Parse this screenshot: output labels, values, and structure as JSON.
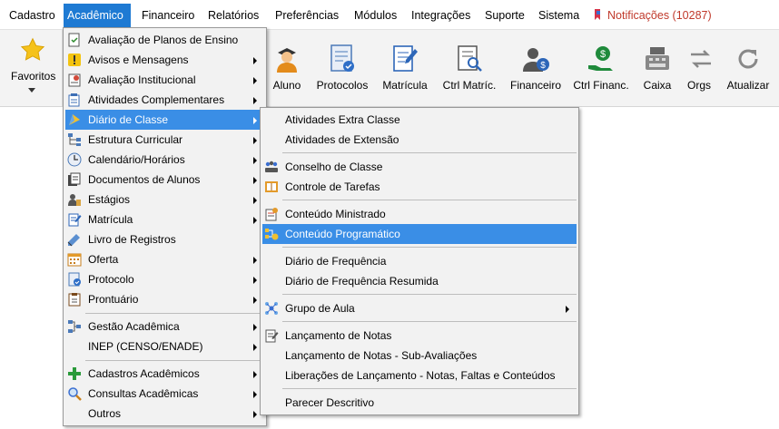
{
  "menubar": {
    "items": [
      "Cadastro",
      "Acadêmico",
      "Financeiro",
      "Relatórios",
      "Preferências",
      "Módulos",
      "Integrações",
      "Suporte",
      "Sistema"
    ],
    "notifications": "Notificações (10287)"
  },
  "toolbar": {
    "favorites": "Favoritos",
    "buttons": [
      "Aluno",
      "Protocolos",
      "Matrícula",
      "Ctrl Matríc.",
      "Financeiro",
      "Ctrl Financ.",
      "Caixa",
      "Orgs",
      "Atualizar"
    ]
  },
  "academic_menu": {
    "items": [
      {
        "label": "Avaliação de Planos de Ensino",
        "icon": "document-check-icon",
        "submenu": false
      },
      {
        "label": "Avisos e Mensagens",
        "icon": "warning-icon",
        "submenu": true
      },
      {
        "label": "Avaliação Institucional",
        "icon": "evaluation-icon",
        "submenu": true
      },
      {
        "label": "Atividades Complementares",
        "icon": "activities-icon",
        "submenu": true
      },
      {
        "label": "Diário de Classe",
        "icon": "class-diary-icon",
        "submenu": true
      },
      {
        "label": "Estrutura Curricular",
        "icon": "curriculum-structure-icon",
        "submenu": true
      },
      {
        "label": "Calendário/Horários",
        "icon": "calendar-icon",
        "submenu": true
      },
      {
        "label": "Documentos de Alunos",
        "icon": "student-documents-icon",
        "submenu": true
      },
      {
        "label": "Estágios",
        "icon": "internship-icon",
        "submenu": true
      },
      {
        "label": "Matrícula",
        "icon": "enrollment-icon",
        "submenu": true
      },
      {
        "label": "Livro de Registros",
        "icon": "register-book-icon",
        "submenu": false
      },
      {
        "label": "Oferta",
        "icon": "offer-icon",
        "submenu": true
      },
      {
        "label": "Protocolo",
        "icon": "protocol-icon",
        "submenu": true
      },
      {
        "label": "Prontuário",
        "icon": "record-icon",
        "submenu": true
      },
      {
        "label": "Gestão Acadêmica",
        "icon": "management-icon",
        "submenu": true
      },
      {
        "label": "INEP (CENSO/ENADE)",
        "icon": "",
        "submenu": true
      },
      {
        "label": "Cadastros Acadêmicos",
        "icon": "plus-icon",
        "submenu": true
      },
      {
        "label": "Consultas Acadêmicas",
        "icon": "magnifier-icon",
        "submenu": true
      },
      {
        "label": "Outros",
        "icon": "",
        "submenu": true
      }
    ]
  },
  "diary_submenu": {
    "items": [
      {
        "label": "Atividades Extra Classe",
        "icon": "",
        "submenu": false
      },
      {
        "label": "Atividades de Extensão",
        "icon": "",
        "submenu": false
      },
      {
        "label": "Conselho de Classe",
        "icon": "council-icon",
        "submenu": false
      },
      {
        "label": "Controle de Tarefas",
        "icon": "tasks-icon",
        "submenu": false
      },
      {
        "label": "Conteúdo Ministrado",
        "icon": "content-taught-icon",
        "submenu": false
      },
      {
        "label": "Conteúdo Programático",
        "icon": "program-content-icon",
        "submenu": false
      },
      {
        "label": "Diário de Frequência",
        "icon": "",
        "submenu": false
      },
      {
        "label": "Diário de Frequência Resumida",
        "icon": "",
        "submenu": false
      },
      {
        "label": "Grupo de Aula",
        "icon": "class-group-icon",
        "submenu": true
      },
      {
        "label": "Lançamento de Notas",
        "icon": "grades-icon",
        "submenu": false
      },
      {
        "label": "Lançamento de Notas - Sub-Avaliações",
        "icon": "",
        "submenu": false
      },
      {
        "label": "Liberações de Lançamento - Notas, Faltas e Conteúdos",
        "icon": "",
        "submenu": false
      },
      {
        "label": "Parecer Descritivo",
        "icon": "",
        "submenu": false
      }
    ]
  },
  "colors": {
    "highlight": "#3a8ee6",
    "menubar_active": "#1e7ad3",
    "notification": "#c0392b"
  }
}
